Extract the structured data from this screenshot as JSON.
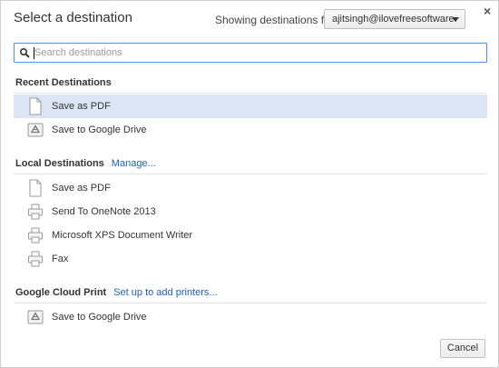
{
  "dialog": {
    "title": "Select a destination",
    "showing_label": "Showing destinations for",
    "account_value": "ajitsingh@ilovefreesoftware.",
    "close_glyph": "×"
  },
  "search": {
    "placeholder": "Search destinations",
    "value": ""
  },
  "recent": {
    "header": "Recent Destinations",
    "items": [
      {
        "label": "Save as PDF",
        "icon": "pdf-page-icon",
        "selected": true
      },
      {
        "label": "Save to Google Drive",
        "icon": "google-drive-icon",
        "selected": false
      }
    ]
  },
  "local": {
    "header": "Local Destinations",
    "link": "Manage...",
    "items": [
      {
        "label": "Save as PDF",
        "icon": "pdf-page-icon"
      },
      {
        "label": "Send To OneNote 2013",
        "icon": "printer-icon"
      },
      {
        "label": "Microsoft XPS Document Writer",
        "icon": "printer-icon"
      },
      {
        "label": "Fax",
        "icon": "printer-icon"
      }
    ]
  },
  "cloud": {
    "header": "Google Cloud Print",
    "link": "Set up to add printers...",
    "items": [
      {
        "label": "Save to Google Drive",
        "icon": "google-drive-icon"
      }
    ]
  },
  "footer": {
    "cancel_label": "Cancel"
  }
}
